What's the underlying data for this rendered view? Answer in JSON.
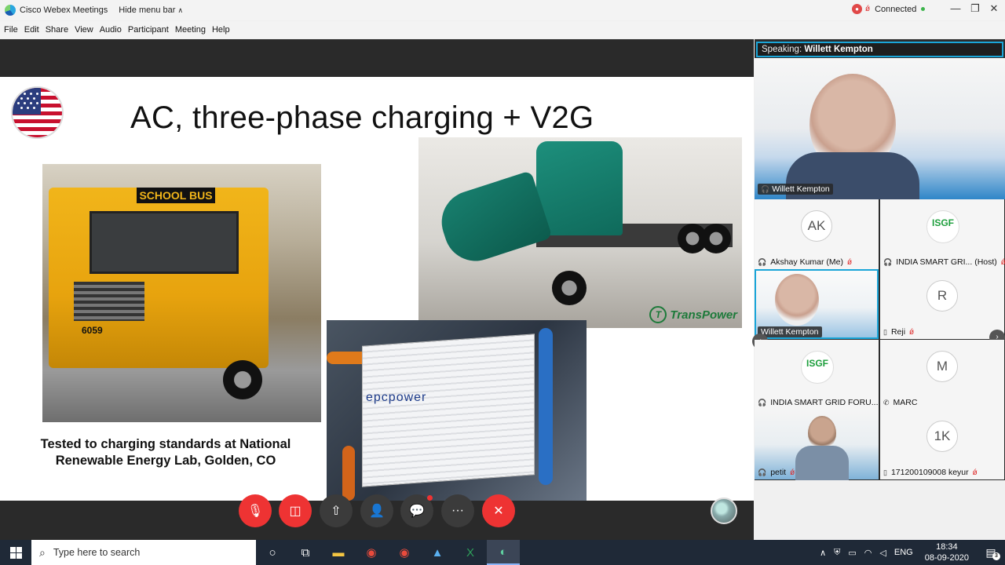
{
  "window": {
    "app_name": "Cisco Webex Meetings",
    "hide_menu_label": "Hide menu bar",
    "status": "Connected",
    "record_icon": "record-icon",
    "controls": [
      "minimize-icon",
      "restore-icon",
      "close-icon"
    ],
    "minimize_glyph": "—",
    "restore_glyph": "❐",
    "close_glyph": "✕"
  },
  "menu": [
    "File",
    "Edit",
    "Share",
    "View",
    "Audio",
    "Participant",
    "Meeting",
    "Help"
  ],
  "slide": {
    "title": "AC, three-phase charging + V2G",
    "caption": "Tested to charging standards at National Renewable Energy Lab, Golden, CO",
    "bus_sign": "SCHOOL BUS",
    "bus_number": "6059",
    "transpower_logo": "TransPower",
    "epc_logo": "epcpower"
  },
  "meeting_controls": [
    {
      "name": "mute-button",
      "icon": "mic-off-icon",
      "glyph": "🎙"
    },
    {
      "name": "stop-video-button",
      "icon": "video-off-icon",
      "glyph": "◫"
    },
    {
      "name": "share-button",
      "icon": "share-icon",
      "glyph": "⇧"
    },
    {
      "name": "participants-button",
      "icon": "participants-icon",
      "glyph": "👤"
    },
    {
      "name": "chat-button",
      "icon": "chat-icon",
      "glyph": "💬"
    },
    {
      "name": "more-options-button",
      "icon": "more-icon",
      "glyph": "···"
    },
    {
      "name": "leave-meeting-button",
      "icon": "close-icon",
      "glyph": "✕"
    }
  ],
  "panel": {
    "speaking_label": "Speaking:",
    "speaking_name": "Willett Kempton",
    "active_speaker_name": "Willett Kempton",
    "participants": [
      {
        "name": "Akshay Kumar",
        "suffix": "(Me)",
        "initials": "AK",
        "muted": true
      },
      {
        "name": "INDIA SMART GRI...",
        "suffix": "(Host)",
        "initials": "ISGF",
        "muted": true
      },
      {
        "name": "Willett Kempton",
        "suffix": "",
        "initials": "",
        "muted": false
      },
      {
        "name": "Reji",
        "suffix": "",
        "initials": "R",
        "muted": true
      },
      {
        "name": "INDIA SMART GRID FORU...",
        "suffix": "",
        "initials": "ISGF",
        "muted": true
      },
      {
        "name": "MARC",
        "suffix": "",
        "initials": "M",
        "muted": false
      },
      {
        "name": "petit",
        "suffix": "",
        "initials": "",
        "muted": true
      },
      {
        "name": "171200109008 keyur",
        "suffix": "",
        "initials": "1K",
        "muted": true
      }
    ]
  },
  "taskbar": {
    "search_placeholder": "Type here to search",
    "language": "ENG",
    "time": "18:34",
    "date": "08-09-2020",
    "notification_count": "3"
  }
}
